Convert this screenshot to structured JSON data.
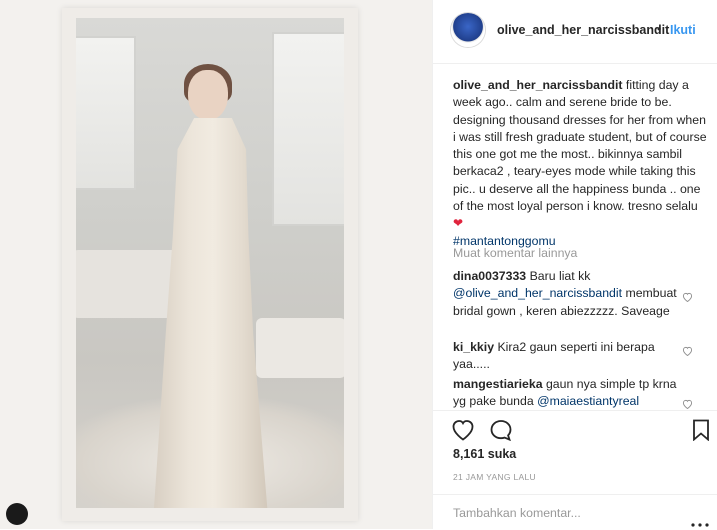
{
  "post": {
    "username": "olive_and_her_narcissbandit",
    "separator": "•",
    "follow_label": "Ikuti",
    "caption_author": "olive_and_her_narcissbandit",
    "caption_text": " fitting day a week ago.. calm and serene bride to be. designing thousand dresses for her from when i was still fresh graduate student, but of course this one got me the most.. bikinnya sambil berkaca2 , teary-eyes mode while taking this pic.. u deserve all the happiness bunda .. one of the most loyal person i know. tresno selalu ",
    "caption_heart": "❤",
    "caption_hashtag": "#mantantonggomu",
    "load_more_label": "Muat komentar lainnya",
    "likes": "8,161 suka",
    "timestamp": "21 JAM YANG LALU",
    "comment_placeholder": "Tambahkan komentar..."
  },
  "comments": [
    {
      "author": "dina0037333",
      "text_before": " Baru liat kk ",
      "mention": "@olive_and_her_narcissbandit",
      "text_after": " membuat bridal gown , keren abiezzzzz. Saveage"
    },
    {
      "author": "ki_kkiy",
      "text_before": " Kira2 gaun seperti ini berapa yaa.....",
      "mention": "",
      "text_after": ""
    },
    {
      "author": "mangestiarieka",
      "text_before": " gaun nya simple tp krna yg pake bunda ",
      "mention": "@maiaestiantyreal",
      "text_after": ""
    }
  ],
  "colors": {
    "link_blue": "#3897f0",
    "hashtag_blue": "#003569",
    "text": "#262626",
    "muted": "#999999",
    "heart_red": "#e0243d"
  },
  "icons": {
    "like": "heart-outline-icon",
    "comment": "comment-bubble-icon",
    "save": "bookmark-icon",
    "more": "more-dots-icon",
    "comment_like": "small-heart-icon"
  }
}
